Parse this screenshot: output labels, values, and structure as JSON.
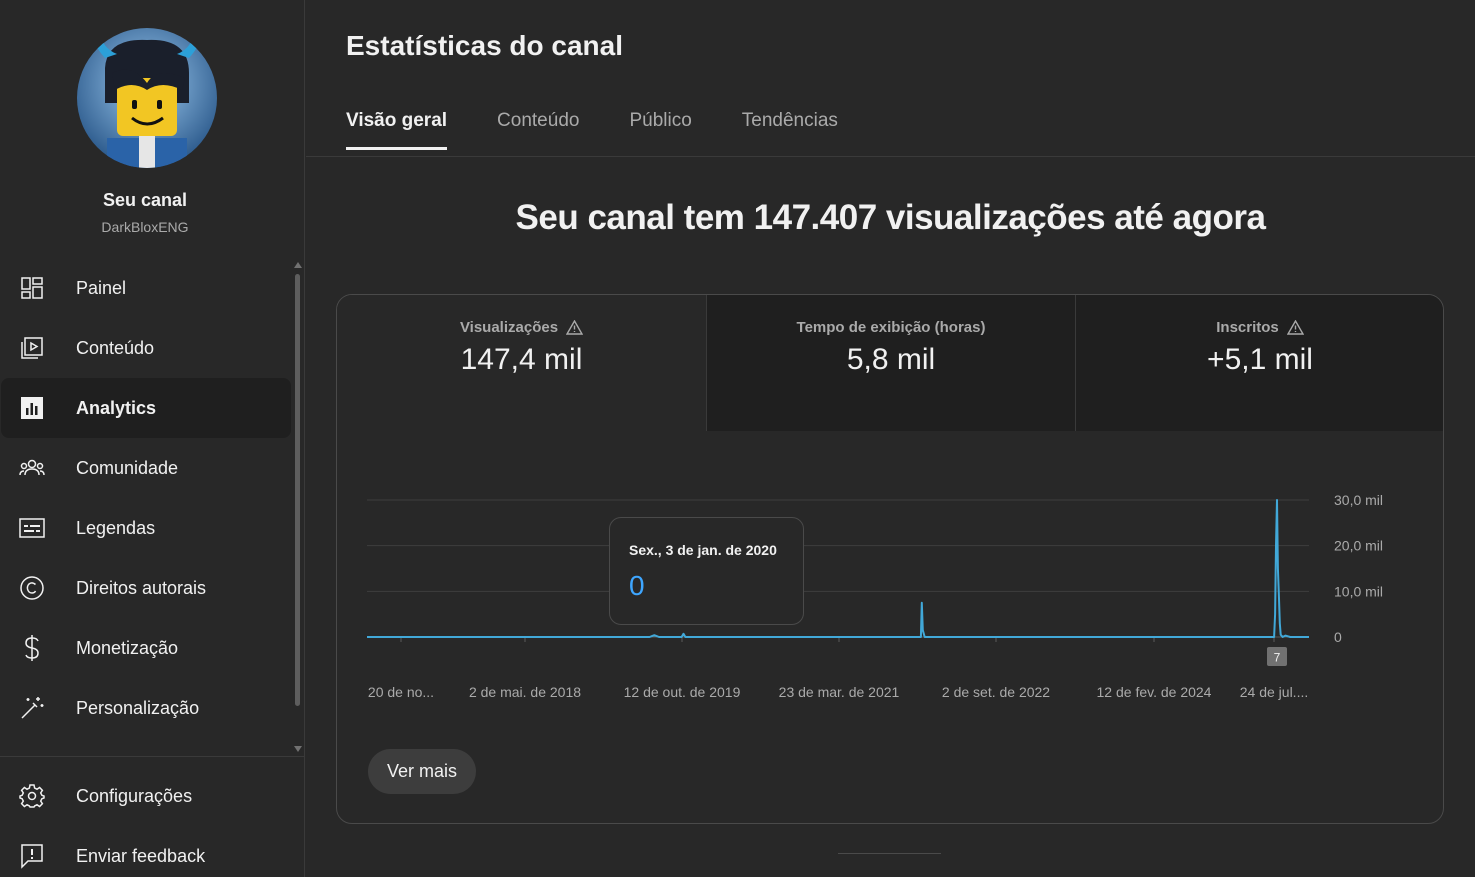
{
  "sidebar": {
    "channel_label": "Seu canal",
    "channel_handle": "DarkBloxENG",
    "items": [
      {
        "label": "Painel",
        "icon": "dashboard-icon"
      },
      {
        "label": "Conteúdo",
        "icon": "content-icon"
      },
      {
        "label": "Analytics",
        "icon": "analytics-icon",
        "active": true
      },
      {
        "label": "Comunidade",
        "icon": "community-icon"
      },
      {
        "label": "Legendas",
        "icon": "subtitles-icon"
      },
      {
        "label": "Direitos autorais",
        "icon": "copyright-icon"
      },
      {
        "label": "Monetização",
        "icon": "dollar-icon"
      },
      {
        "label": "Personalização",
        "icon": "magic-wand-icon"
      }
    ],
    "bottom_items": [
      {
        "label": "Configurações",
        "icon": "gear-icon"
      },
      {
        "label": "Enviar feedback",
        "icon": "feedback-icon"
      }
    ]
  },
  "page": {
    "title": "Estatísticas do canal",
    "tabs": [
      {
        "label": "Visão geral",
        "active": true
      },
      {
        "label": "Conteúdo"
      },
      {
        "label": "Público"
      },
      {
        "label": "Tendências"
      }
    ],
    "headline": "Seu canal tem 147.407 visualizações até agora"
  },
  "metrics": [
    {
      "label": "Visualizações",
      "value": "147,4 mil",
      "warning": true,
      "selected": true
    },
    {
      "label": "Tempo de exibição (horas)",
      "value": "5,8 mil",
      "warning": false
    },
    {
      "label": "Inscritos",
      "value": "+5,1 mil",
      "warning": true
    }
  ],
  "tooltip": {
    "date": "Sex., 3 de jan. de 2020",
    "value": "0"
  },
  "ver_mais_label": "Ver mais",
  "colors": {
    "accent": "#3ea6ff",
    "line": "#41a8d8",
    "background": "#282828"
  },
  "chart_data": {
    "type": "line",
    "y_tick_labels": [
      "30,0 mil",
      "20,0 mil",
      "10,0 mil",
      "0"
    ],
    "ylim": [
      0,
      30000
    ],
    "x_tick_labels": [
      "20 de no...",
      "2 de mai. de 2018",
      "12 de out. de 2019",
      "23 de mar. de 2021",
      "2 de set. de 2022",
      "12 de fev. de 2024",
      "24 de jul...."
    ],
    "marker_label": "7",
    "grid": true,
    "series": [
      {
        "x": [
          0.0,
          0.3,
          0.3,
          0.3,
          0.305,
          0.31,
          0.334,
          0.336,
          0.338,
          0.34,
          0.588,
          0.589,
          0.59,
          0.592,
          0.6,
          0.963,
          0.964,
          0.965,
          0.966,
          0.967,
          0.968,
          0.969,
          0.97,
          0.972,
          0.975,
          0.98,
          1.0
        ],
        "values": [
          0,
          0,
          0,
          0,
          400,
          0,
          0,
          700,
          0,
          0,
          0,
          7500,
          1500,
          0,
          0,
          0,
          5000,
          20000,
          30000,
          15000,
          9000,
          3000,
          500,
          0,
          300,
          0,
          0
        ]
      }
    ]
  }
}
